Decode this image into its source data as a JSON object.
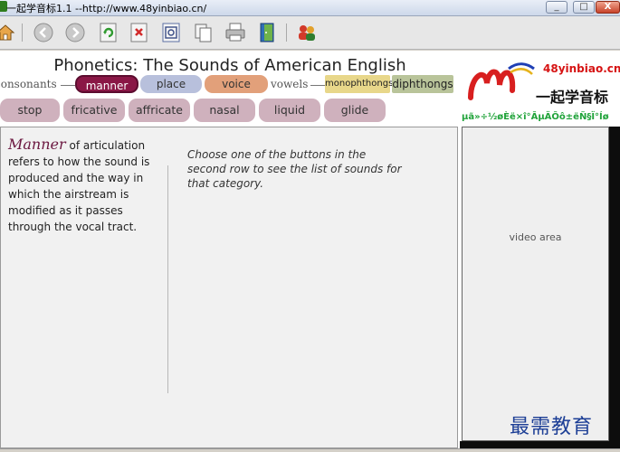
{
  "window": {
    "title": "一起学音标1.1 --http://www.48yinbiao.cn/",
    "min_glyph": "_",
    "max_glyph": "□",
    "close_glyph": "X"
  },
  "toolbar": {
    "icons": [
      "home-icon",
      "back-icon",
      "forward-icon",
      "refresh-icon",
      "stop-icon",
      "favorites-icon",
      "copy-icon",
      "print-icon",
      "exit-icon",
      "users-icon"
    ]
  },
  "app": {
    "title": "Phonetics:  The Sounds of American English",
    "consonants_label": "consonants",
    "vowels_label": "vowels",
    "consonant_tabs": [
      "manner",
      "place",
      "voice"
    ],
    "vowel_tabs": [
      "monophthongs",
      "diphthongs"
    ],
    "manner_buttons": [
      "stop",
      "fricative",
      "affricate",
      "nasal",
      "liquid",
      "glide"
    ],
    "description": {
      "lead": "Manner",
      "rest": " of articulation refers to how the sound is produced and the way in which the airstream is modified as it passes through the vocal tract."
    },
    "instructions": "Choose one of the buttons in the second row to see the list of sounds for that category."
  },
  "logo": {
    "url": "48yinbiao.cn",
    "name": "一起学音标",
    "garbled": "µã»÷½øÈë×î°ÃµÄÕô±ëÑ§Ï°Íø"
  },
  "video": {
    "label": "video area"
  },
  "watermark": "最需教育",
  "colors": {
    "manner": "#8a1746",
    "place": "#b8c0dc",
    "voice": "#e2a07a",
    "monophthongs": "#e8d78a",
    "diphthongs": "#b9c49a",
    "row2": "#cfb1bd"
  }
}
